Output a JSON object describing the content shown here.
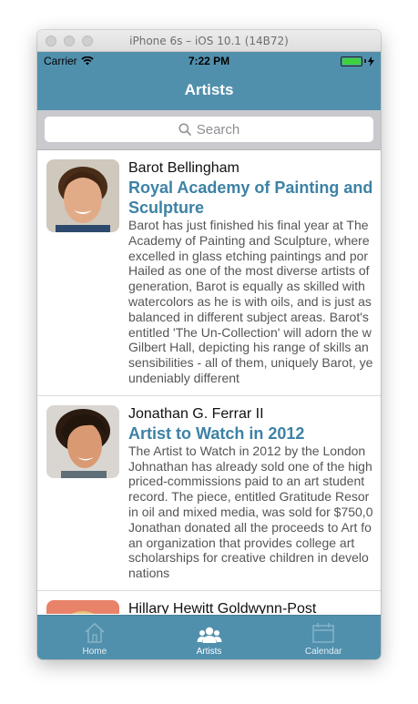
{
  "window": {
    "title": "iPhone 6s – iOS 10.1 (14B72)"
  },
  "status": {
    "carrier": "Carrier",
    "time": "7:22 PM",
    "battery_level": 1.0,
    "battery_color": "#3ed13e"
  },
  "nav": {
    "title": "Artists"
  },
  "search": {
    "placeholder": "Search"
  },
  "colors": {
    "accent": "#5190ad",
    "headline": "#3c82a5"
  },
  "artists": [
    {
      "name": "Barot Bellingham",
      "headline": "Royal Academy of Painting and\nSculpture",
      "bio": "Barot has just finished his final year at The\nAcademy of Painting and Sculpture, where\nexcelled in glass etching paintings and por\nHailed as one of the most diverse artists of\ngeneration, Barot is equally as skilled with\nwatercolors as he is with oils, and is just as\nbalanced in different subject areas. Barot's\nentitled 'The Un-Collection' will adorn the w\nGilbert Hall, depicting his range of skills an\nsensibilities - all of them, uniquely Barot, ye\nundeniably different"
    },
    {
      "name": "Jonathan G. Ferrar II",
      "headline": "Artist to Watch in 2012",
      "bio": "The Artist to Watch in 2012 by the London\nJohnathan has already sold one of the high\npriced-commissions paid to an art student\nrecord. The piece, entitled Gratitude Resor\nin oil and mixed media, was sold for $750,0\nJonathan donated all the proceeds to Art fo\nan organization that provides college art\nscholarships for creative children in develo\nnations"
    },
    {
      "name": "Hillary Hewitt Goldwynn-Post",
      "headline": "",
      "bio": ""
    }
  ],
  "tabs": [
    {
      "label": "Home",
      "icon": "home-icon"
    },
    {
      "label": "Artists",
      "icon": "artists-icon",
      "active": true
    },
    {
      "label": "Calendar",
      "icon": "calendar-icon"
    }
  ]
}
